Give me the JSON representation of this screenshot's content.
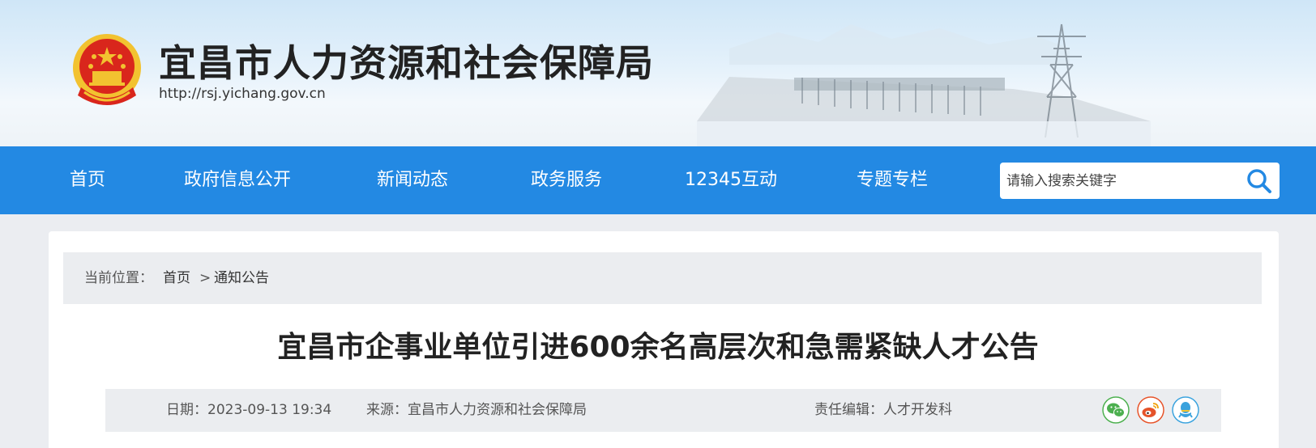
{
  "site": {
    "title": "宜昌市人力资源和社会保障局",
    "url": "http://rsj.yichang.gov.cn"
  },
  "nav": {
    "items": [
      {
        "label": "首页"
      },
      {
        "label": "政府信息公开"
      },
      {
        "label": "新闻动态"
      },
      {
        "label": "政务服务"
      },
      {
        "label": "12345互动"
      },
      {
        "label": "专题专栏"
      }
    ],
    "search_placeholder": "请输入搜索关键字",
    "search_icon": "search-icon"
  },
  "breadcrumb": {
    "prefix": "当前位置：",
    "home": "首页",
    "separator": ">",
    "current": "通知公告"
  },
  "article": {
    "title": "宜昌市企事业单位引进600余名高层次和急需紧缺人才公告",
    "date_label": "日期：2023-09-13 19:34",
    "source_label": "来源：宜昌市人力资源和社会保障局",
    "editor_label": "责任编辑：人才开发科"
  },
  "share": {
    "icons": [
      "wechat-icon",
      "weibo-icon",
      "qq-icon"
    ],
    "colors": {
      "wechat": "#4caf4f",
      "weibo": "#e5532a",
      "qq": "#3aa2dd"
    }
  },
  "colors": {
    "nav_bg": "#2389e3",
    "page_bg": "#ebedf1",
    "emblem_red": "#d9261c",
    "emblem_gold": "#f2c230"
  }
}
